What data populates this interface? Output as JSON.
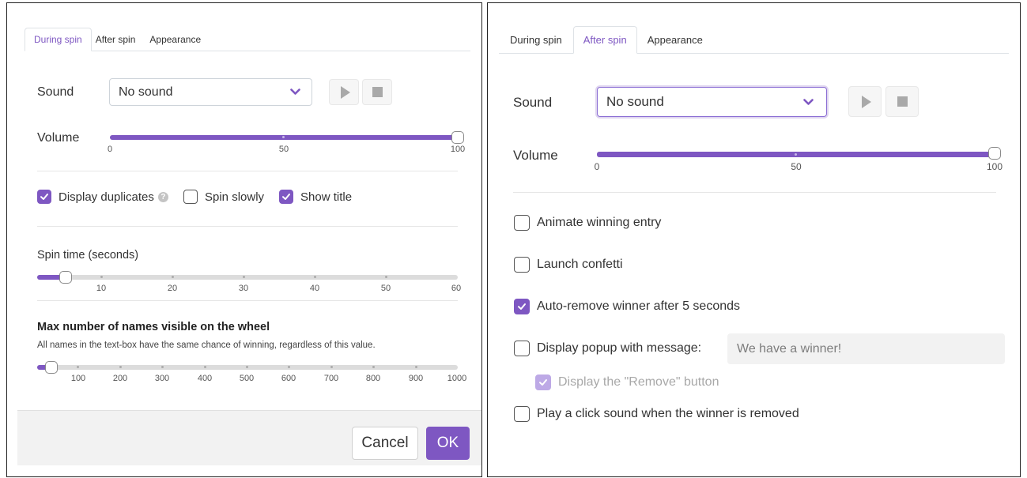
{
  "left": {
    "tabs": [
      "During spin",
      "After spin",
      "Appearance"
    ],
    "active_tab": "During spin",
    "sound_label": "Sound",
    "sound_value": "No sound",
    "volume_label": "Volume",
    "volume": {
      "value": 100,
      "ticks": [
        "0",
        "50",
        "100"
      ]
    },
    "checkboxes": {
      "display_duplicates": {
        "label": "Display duplicates",
        "checked": true
      },
      "spin_slowly": {
        "label": "Spin slowly",
        "checked": false
      },
      "show_title": {
        "label": "Show title",
        "checked": true
      }
    },
    "spin_time_label": "Spin time (seconds)",
    "spin_time": {
      "value": 4,
      "ticks": [
        "10",
        "20",
        "30",
        "40",
        "50",
        "60"
      ]
    },
    "max_names_title": "Max number of names visible on the wheel",
    "max_names_desc": "All names in the text-box have the same chance of winning, regardless of this value.",
    "max_names": {
      "value": 20,
      "ticks": [
        "100",
        "200",
        "300",
        "400",
        "500",
        "600",
        "700",
        "800",
        "900",
        "1000"
      ]
    },
    "cancel_label": "Cancel",
    "ok_label": "OK"
  },
  "right": {
    "tabs": [
      "During spin",
      "After spin",
      "Appearance"
    ],
    "active_tab": "After spin",
    "sound_label": "Sound",
    "sound_value": "No sound",
    "volume_label": "Volume",
    "volume": {
      "value": 100,
      "ticks": [
        "0",
        "50",
        "100"
      ]
    },
    "animate_winning": {
      "label": "Animate winning entry",
      "checked": false
    },
    "launch_confetti": {
      "label": "Launch confetti",
      "checked": false
    },
    "auto_remove": {
      "label": "Auto-remove winner after 5 seconds",
      "checked": true
    },
    "display_popup": {
      "label": "Display popup with message:",
      "checked": false
    },
    "popup_message": "We have a winner!",
    "display_remove": {
      "label": "Display the \"Remove\" button",
      "checked": true
    },
    "click_sound": {
      "label": "Play a click sound when the winner is removed",
      "checked": false
    }
  },
  "colors": {
    "accent": "#7e57c2",
    "track": "#dcdcdc"
  },
  "icons": [
    "chevron-down-icon",
    "play-icon",
    "stop-icon",
    "help-icon",
    "check-icon"
  ]
}
